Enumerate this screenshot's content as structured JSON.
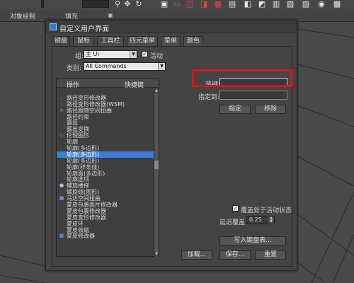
{
  "toolbar": {
    "field1": "",
    "field2": "",
    "label_object_paint": "对象绘制",
    "label_populate": "填充"
  },
  "dialog": {
    "title": "自定义用户界面",
    "tabs": [
      "键盘",
      "鼠标",
      "工具栏",
      "四元菜单",
      "菜单",
      "颜色"
    ],
    "group_label": "组:",
    "group_value": "主 UI",
    "active_label": "活动",
    "category_label": "类别:",
    "category_value": "All Commands",
    "list": {
      "col_action": "操作",
      "col_shortcut": "快捷键",
      "rows": [
        {
          "label": "",
          "icon": ""
        },
        {
          "label": "路径变形修改器",
          "icon": "path-deform-icon"
        },
        {
          "label": "路径变形修改器(WSM)",
          "icon": "path-deform-icon"
        },
        {
          "label": "路径跟随空间扭曲",
          "icon": "path-follow-icon"
        },
        {
          "label": "路径约束",
          "icon": ""
        },
        {
          "label": "露出",
          "icon": ""
        },
        {
          "label": "露出变换",
          "icon": ""
        },
        {
          "label": "伦理图形",
          "icon": "shape-icon"
        },
        {
          "label": "轮廓",
          "icon": ""
        },
        {
          "label": "轮廓(多边形)",
          "icon": ""
        },
        {
          "label": "轮廓(多边形)",
          "icon": ""
        },
        {
          "label": "轮廓(多边形)",
          "icon": ""
        },
        {
          "label": "轮廓(样条线)",
          "icon": ""
        },
        {
          "label": "轮廓面(多边形)",
          "icon": ""
        },
        {
          "label": "轮廓选项",
          "icon": ""
        },
        {
          "label": "螺旋楼梯",
          "icon": "sphere-icon"
        },
        {
          "label": "螺旋线(图形)",
          "icon": ""
        },
        {
          "label": "马达空间扭曲",
          "icon": "motor-icon"
        },
        {
          "label": "蒙皮包裹面片修改器",
          "icon": ""
        },
        {
          "label": "蒙皮包裹修改器",
          "icon": ""
        },
        {
          "label": "蒙皮变形修改器",
          "icon": ""
        },
        {
          "label": "蒙皮环",
          "icon": ""
        },
        {
          "label": "蒙皮收缩",
          "icon": ""
        },
        {
          "label": "蒙皮修改器",
          "icon": "skin-icon"
        },
        {
          "label": "",
          "icon": ""
        },
        {
          "label": "",
          "icon": ""
        },
        {
          "label": "",
          "icon": ""
        }
      ],
      "selected_index": 10,
      "scroll_position": 0.45
    },
    "hotkey_label": "热键:",
    "hotkey_value": "",
    "assigned_to_label": "指定到:",
    "assigned_to_value": "",
    "assign_button": "指定",
    "remove_button": "移除",
    "override_label": "覆盖处于活动状态",
    "delay_override_label": "延迟覆盖",
    "delay_override_value": "0.25",
    "write_keyboard_chart_button": "写入键盘表...",
    "load_button": "加载...",
    "save_button": "保存...",
    "reset_button": "重置"
  },
  "colors": {
    "highlight": "#e3101a",
    "selection": "#3d7fd6"
  }
}
